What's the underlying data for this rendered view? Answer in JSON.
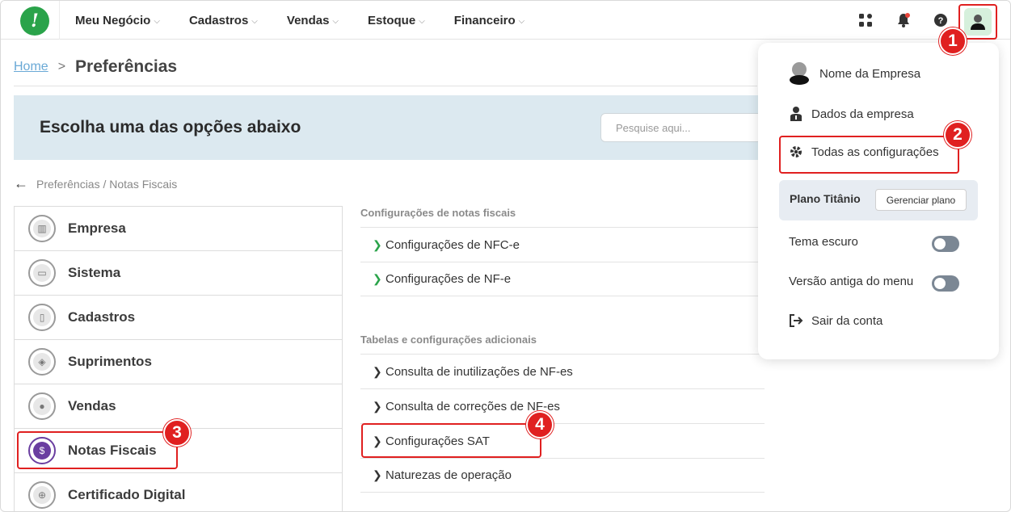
{
  "nav": {
    "items": [
      {
        "label": "Meu Negócio"
      },
      {
        "label": "Cadastros"
      },
      {
        "label": "Vendas"
      },
      {
        "label": "Estoque"
      },
      {
        "label": "Financeiro"
      }
    ],
    "icons": [
      "apps-icon",
      "bell-icon",
      "help-icon",
      "user-avatar-icon"
    ],
    "notification_dot_color": "#e8443a"
  },
  "breadcrumb": {
    "home": "Home",
    "separator": ">",
    "title": "Preferências"
  },
  "banner": {
    "title": "Escolha uma das opções abaixo",
    "search_placeholder": "Pesquise aqui..."
  },
  "back": {
    "path": "Preferências / Notas Fiscais"
  },
  "left_menu": {
    "items": [
      {
        "label": "Empresa",
        "icon": "building-icon"
      },
      {
        "label": "Sistema",
        "icon": "monitor-icon"
      },
      {
        "label": "Cadastros",
        "icon": "book-icon"
      },
      {
        "label": "Suprimentos",
        "icon": "box-icon"
      },
      {
        "label": "Vendas",
        "icon": "users-icon"
      },
      {
        "label": "Notas Fiscais",
        "icon": "invoice-icon",
        "active": true
      },
      {
        "label": "Certificado Digital",
        "icon": "lock-icon"
      }
    ]
  },
  "content": {
    "section1_title": "Configurações de notas fiscais",
    "section1_rows": [
      "Configurações de NFC-e",
      "Configurações de NF-e"
    ],
    "section2_title": "Tabelas e configurações adicionais",
    "section2_rows": [
      "Consulta de inutilizações de NF-es",
      "Consulta de correções de NF-es",
      "Configurações SAT",
      "Naturezas de operação"
    ]
  },
  "dropdown": {
    "company_name": "Nome da Empresa",
    "company_data": "Dados da empresa",
    "all_settings": "Todas as configurações",
    "plan_name": "Plano Titânio",
    "manage_plan": "Gerenciar plano",
    "dark_theme": "Tema escuro",
    "old_menu": "Versão antiga do menu",
    "logout": "Sair da conta"
  },
  "markers": [
    "1",
    "2",
    "3",
    "4"
  ],
  "colors": {
    "brand_green": "#2aa34a",
    "highlight_red": "#e02020",
    "banner_bg": "#dce9f0",
    "active_purple": "#6a3ea0"
  }
}
